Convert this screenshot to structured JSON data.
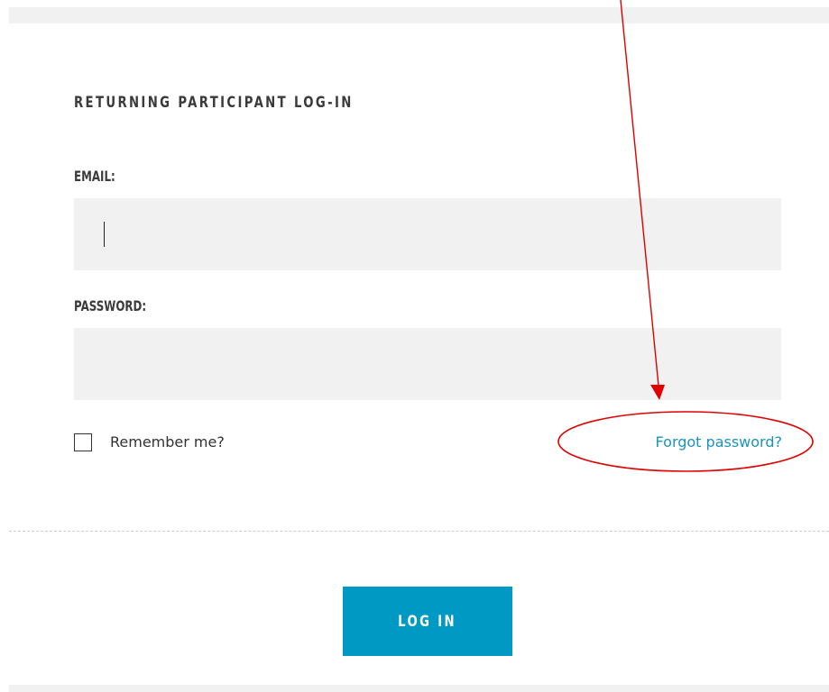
{
  "login_form": {
    "title": "RETURNING PARTICIPANT LOG-IN",
    "email": {
      "label": "EMAIL:",
      "value": "",
      "placeholder": ""
    },
    "password": {
      "label": "PASSWORD:",
      "value": "",
      "placeholder": ""
    },
    "remember_me": {
      "label": "Remember me?",
      "checked": false
    },
    "forgot_password_label": "Forgot password?",
    "submit_label": "LOG IN"
  },
  "colors": {
    "accent": "#0099c4",
    "link": "#1c93bb",
    "field_background": "#f1f1f1",
    "annotation": "#e00000"
  }
}
